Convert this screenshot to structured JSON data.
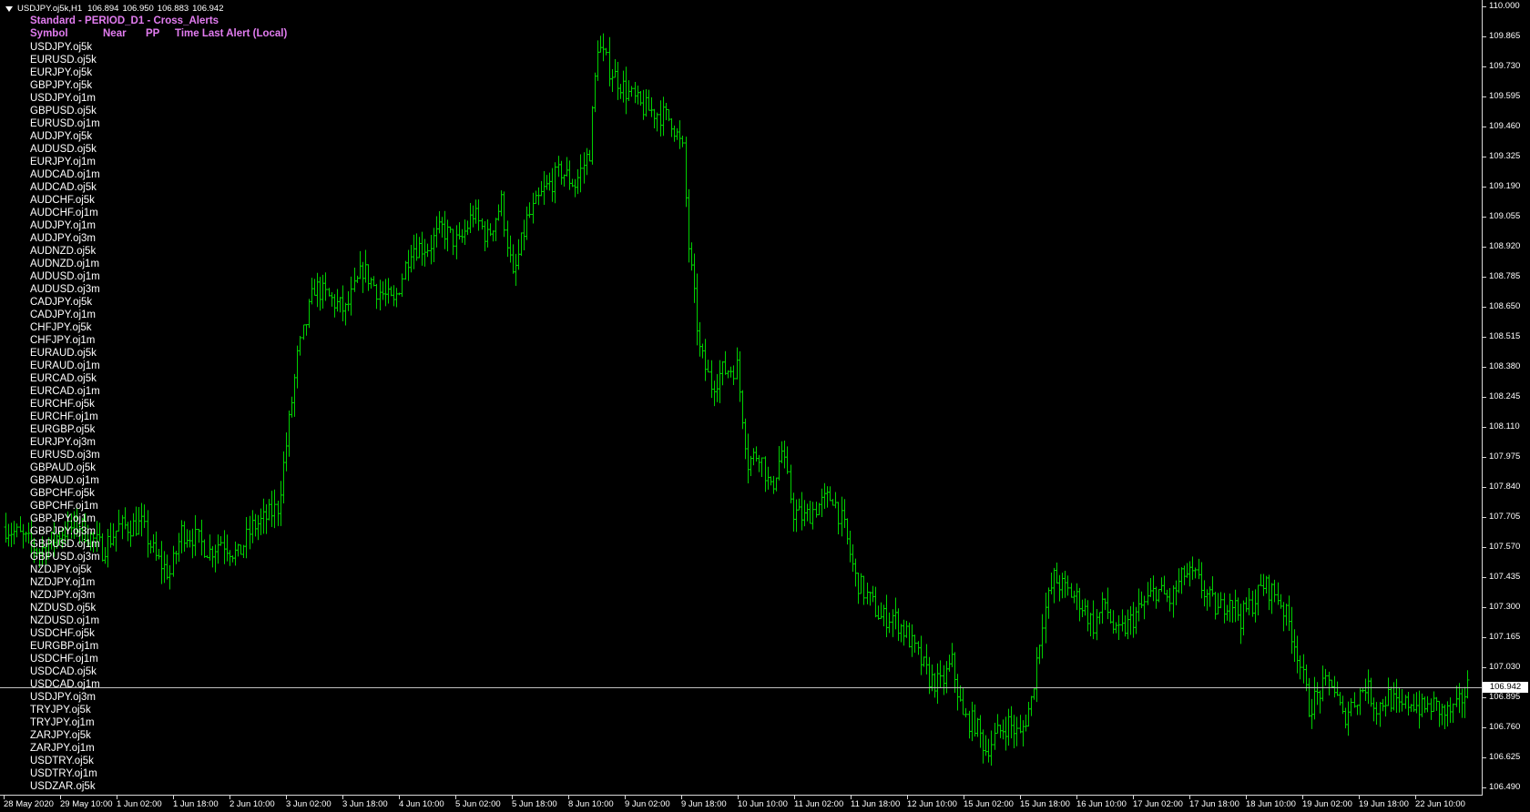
{
  "header": {
    "symbol_tf": "USDJPY.oj5k,H1",
    "ohlc": [
      "106.894",
      "106.950",
      "106.883",
      "106.942"
    ]
  },
  "panel": {
    "title": "Standard - PERIOD_D1 - Cross_Alerts",
    "columns": [
      "Symbol",
      "Near",
      "PP",
      "Time Last Alert (Local)"
    ],
    "symbols": [
      "USDJPY.oj5k",
      "EURUSD.oj5k",
      "EURJPY.oj5k",
      "GBPJPY.oj5k",
      "USDJPY.oj1m",
      "GBPUSD.oj5k",
      "EURUSD.oj1m",
      "AUDJPY.oj5k",
      "AUDUSD.oj5k",
      "EURJPY.oj1m",
      "AUDCAD.oj1m",
      "AUDCAD.oj5k",
      "AUDCHF.oj5k",
      "AUDCHF.oj1m",
      "AUDJPY.oj1m",
      "AUDJPY.oj3m",
      "AUDNZD.oj5k",
      "AUDNZD.oj1m",
      "AUDUSD.oj1m",
      "AUDUSD.oj3m",
      "CADJPY.oj5k",
      "CADJPY.oj1m",
      "CHFJPY.oj5k",
      "CHFJPY.oj1m",
      "EURAUD.oj5k",
      "EURAUD.oj1m",
      "EURCAD.oj5k",
      "EURCAD.oj1m",
      "EURCHF.oj5k",
      "EURCHF.oj1m",
      "EURGBP.oj5k",
      "EURJPY.oj3m",
      "EURUSD.oj3m",
      "GBPAUD.oj5k",
      "GBPAUD.oj1m",
      "GBPCHF.oj5k",
      "GBPCHF.oj1m",
      "GBPJPY.oj1m",
      "GBPJPY.oj3m",
      "GBPUSD.oj1m",
      "GBPUSD.oj3m",
      "NZDJPY.oj5k",
      "NZDJPY.oj1m",
      "NZDJPY.oj3m",
      "NZDUSD.oj5k",
      "NZDUSD.oj1m",
      "USDCHF.oj5k",
      "EURGBP.oj1m",
      "USDCHF.oj1m",
      "USDCAD.oj5k",
      "USDCAD.oj1m",
      "USDJPY.oj3m",
      "TRYJPY.oj5k",
      "TRYJPY.oj1m",
      "ZARJPY.oj5k",
      "ZARJPY.oj1m",
      "USDTRY.oj5k",
      "USDTRY.oj1m",
      "USDZAR.oj5k"
    ]
  },
  "price_axis": {
    "labels": [
      "110.000",
      "109.865",
      "109.730",
      "109.595",
      "109.460",
      "109.325",
      "109.190",
      "109.055",
      "108.920",
      "108.785",
      "108.650",
      "108.515",
      "108.380",
      "108.245",
      "108.110",
      "107.975",
      "107.840",
      "107.705",
      "107.570",
      "107.435",
      "107.300",
      "107.165",
      "107.030",
      "106.895",
      "106.760",
      "106.625",
      "106.490"
    ],
    "current": "106.942"
  },
  "time_axis": {
    "labels": [
      "28 May 2020",
      "29 May 10:00",
      "1 Jun 02:00",
      "1 Jun 18:00",
      "2 Jun 10:00",
      "3 Jun 02:00",
      "3 Jun 18:00",
      "4 Jun 10:00",
      "5 Jun 02:00",
      "5 Jun 18:00",
      "8 Jun 10:00",
      "9 Jun 02:00",
      "9 Jun 18:00",
      "10 Jun 10:00",
      "11 Jun 02:00",
      "11 Jun 18:00",
      "12 Jun 10:00",
      "15 Jun 02:00",
      "15 Jun 18:00",
      "16 Jun 10:00",
      "17 Jun 02:00",
      "17 Jun 18:00",
      "18 Jun 10:00",
      "19 Jun 02:00",
      "19 Jun 18:00",
      "22 Jun 10:00"
    ]
  },
  "colors": {
    "background": "#000000",
    "bars": "#00d000",
    "text": "#ffffff",
    "panel_text": "#e27cf0",
    "bid_line": "#c0c0c0"
  },
  "chart_data": {
    "type": "ohlc",
    "symbol": "USDJPY.oj5k",
    "timeframe": "H1",
    "ylim": [
      106.49,
      110.0
    ],
    "anchors": [
      [
        0,
        107.66
      ],
      [
        5,
        107.62
      ],
      [
        12,
        107.55
      ],
      [
        20,
        107.64
      ],
      [
        26,
        107.67
      ],
      [
        34,
        107.56
      ],
      [
        40,
        107.66
      ],
      [
        48,
        107.67
      ],
      [
        53,
        107.52
      ],
      [
        58,
        107.45
      ],
      [
        62,
        107.64
      ],
      [
        66,
        107.62
      ],
      [
        72,
        107.55
      ],
      [
        76,
        107.6
      ],
      [
        82,
        107.53
      ],
      [
        87,
        107.66
      ],
      [
        91,
        107.69
      ],
      [
        96,
        107.75
      ],
      [
        99,
        108.03
      ],
      [
        103,
        108.42
      ],
      [
        109,
        108.74
      ],
      [
        115,
        108.68
      ],
      [
        120,
        108.63
      ],
      [
        126,
        108.82
      ],
      [
        131,
        108.73
      ],
      [
        137,
        108.66
      ],
      [
        143,
        108.92
      ],
      [
        149,
        108.92
      ],
      [
        154,
        109.0
      ],
      [
        160,
        108.93
      ],
      [
        165,
        109.07
      ],
      [
        170,
        108.96
      ],
      [
        175,
        109.12
      ],
      [
        179,
        108.77
      ],
      [
        184,
        109.04
      ],
      [
        190,
        109.17
      ],
      [
        196,
        109.26
      ],
      [
        201,
        109.2
      ],
      [
        206,
        109.35
      ],
      [
        209,
        109.83
      ],
      [
        213,
        109.72
      ],
      [
        219,
        109.62
      ],
      [
        224,
        109.55
      ],
      [
        230,
        109.52
      ],
      [
        235,
        109.49
      ],
      [
        239,
        109.35
      ],
      [
        241,
        108.92
      ],
      [
        245,
        108.45
      ],
      [
        249,
        108.3
      ],
      [
        253,
        108.36
      ],
      [
        258,
        108.38
      ],
      [
        262,
        107.95
      ],
      [
        266,
        108.0
      ],
      [
        270,
        107.82
      ],
      [
        274,
        108.0
      ],
      [
        278,
        107.73
      ],
      [
        282,
        107.7
      ],
      [
        286,
        107.75
      ],
      [
        292,
        107.8
      ],
      [
        296,
        107.65
      ],
      [
        300,
        107.43
      ],
      [
        305,
        107.33
      ],
      [
        309,
        107.25
      ],
      [
        313,
        107.26
      ],
      [
        318,
        107.18
      ],
      [
        322,
        107.08
      ],
      [
        326,
        106.98
      ],
      [
        330,
        106.95
      ],
      [
        334,
        107.05
      ],
      [
        338,
        106.8
      ],
      [
        342,
        106.78
      ],
      [
        346,
        106.66
      ],
      [
        350,
        106.73
      ],
      [
        354,
        106.78
      ],
      [
        358,
        106.72
      ],
      [
        362,
        106.88
      ],
      [
        366,
        107.25
      ],
      [
        370,
        107.43
      ],
      [
        374,
        107.38
      ],
      [
        379,
        107.33
      ],
      [
        384,
        107.22
      ],
      [
        388,
        107.32
      ],
      [
        392,
        107.17
      ],
      [
        396,
        107.22
      ],
      [
        401,
        107.3
      ],
      [
        406,
        107.38
      ],
      [
        411,
        107.33
      ],
      [
        416,
        107.45
      ],
      [
        420,
        107.43
      ],
      [
        424,
        107.35
      ],
      [
        428,
        107.28
      ],
      [
        432,
        107.35
      ],
      [
        436,
        107.25
      ],
      [
        440,
        107.32
      ],
      [
        444,
        107.4
      ],
      [
        449,
        107.35
      ],
      [
        453,
        107.23
      ],
      [
        456,
        107.1
      ],
      [
        460,
        106.85
      ],
      [
        464,
        106.92
      ],
      [
        468,
        106.97
      ],
      [
        472,
        106.8
      ],
      [
        476,
        106.88
      ],
      [
        480,
        106.95
      ],
      [
        484,
        106.85
      ],
      [
        488,
        106.9
      ],
      [
        492,
        106.84
      ],
      [
        496,
        106.88
      ],
      [
        500,
        106.84
      ],
      [
        504,
        106.86
      ],
      [
        508,
        106.82
      ],
      [
        512,
        106.84
      ],
      [
        516,
        106.94
      ]
    ]
  }
}
